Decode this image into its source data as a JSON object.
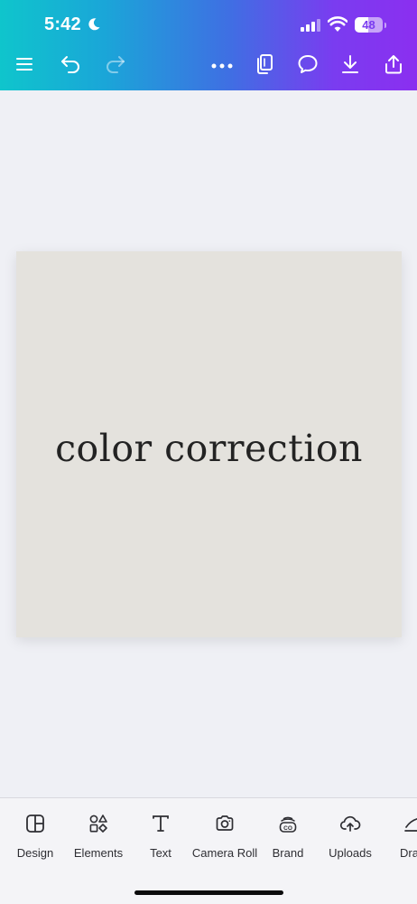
{
  "status_bar": {
    "time": "5:42",
    "battery_level": 48,
    "battery_label": "48"
  },
  "toolbar": {
    "icons": [
      "menu-icon",
      "undo-icon",
      "redo-icon",
      "more-icon",
      "pages-icon",
      "comment-icon",
      "download-icon",
      "share-icon"
    ]
  },
  "canvas": {
    "text": "color correction",
    "background": "#e4e2dd"
  },
  "colors": {
    "gradient_start": "#0fc5cc",
    "gradient_end": "#8b2ff0",
    "app_background": "#eff0f5"
  },
  "bottom_nav": {
    "items": [
      {
        "label": "Design",
        "icon": "design-icon"
      },
      {
        "label": "Elements",
        "icon": "elements-icon"
      },
      {
        "label": "Text",
        "icon": "text-icon"
      },
      {
        "label": "Camera Roll",
        "icon": "camera-icon"
      },
      {
        "label": "Brand",
        "icon": "brand-icon"
      },
      {
        "label": "Uploads",
        "icon": "upload-cloud-icon"
      },
      {
        "label": "Dra",
        "icon": "draw-icon"
      }
    ]
  }
}
